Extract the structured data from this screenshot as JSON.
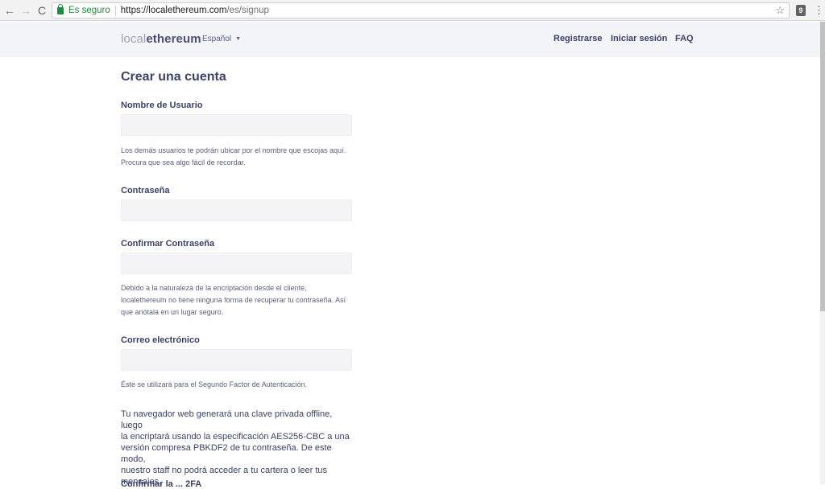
{
  "browser": {
    "secure_label": "Es seguro",
    "url_base": "https://localethereum.com",
    "url_path": "/es/signup",
    "back_glyph": "←",
    "forward_glyph": "→",
    "reload_glyph": "C",
    "star_glyph": "☆",
    "ext_glyph": "9",
    "menu_glyph": "⋮"
  },
  "header": {
    "logo_light": "local",
    "logo_bold": "ethereum",
    "language": "Español",
    "caret": "▼",
    "nav": {
      "register": "Registrarse",
      "login": "Iniciar sesión",
      "faq": "FAQ"
    }
  },
  "form": {
    "title": "Crear una cuenta",
    "username": {
      "label": "Nombre de Usuario",
      "value": "",
      "help_line1": "Los demás usuarios te podrán ubicar por el nombre que escojas aquí.",
      "help_line2": "Procura que sea algo fácil de recordar."
    },
    "password": {
      "label": "Contraseña",
      "value": ""
    },
    "confirm_password": {
      "label": "Confirmar Contraseña",
      "value": "",
      "help_line1": "Debido a la naturaleza de la encriptación desde el cliente,",
      "help_line2": "localethereum no tiene ninguna forma de recuperar tu contraseña. Así",
      "help_line3": "que anótala en un lugar seguro."
    },
    "email": {
      "label": "Correo electrónico",
      "value": "",
      "help": "Éste se utilizará para el Segundo Factor de Autenticación."
    },
    "info_line1": "Tu navegador web generará una clave privada offline, luego",
    "info_line2": "la encriptará usando la especificación AES256-CBC a una",
    "info_line3": "versión compresa PBKDF2 de tu contraseña. De este modo,",
    "info_line4": "nuestro staff no podrá acceder a tu cartera o leer tus",
    "info_line5": "mensajes.",
    "cut_off_label": "Confirmar la ... 2FA"
  }
}
